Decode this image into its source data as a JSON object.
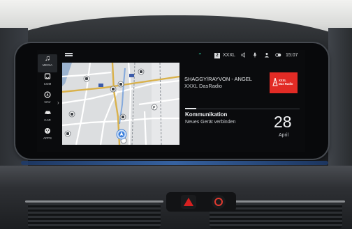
{
  "sidebar": {
    "items": [
      {
        "label": "MEDIA",
        "icon": "music-note-icon",
        "active": true
      },
      {
        "label": "COM",
        "icon": "phone-icon",
        "active": false
      },
      {
        "label": "NAV",
        "icon": "navigation-icon",
        "active": false
      },
      {
        "label": "CAR",
        "icon": "car-icon",
        "active": false
      },
      {
        "label": "APPS",
        "icon": "apps-icon",
        "active": false
      }
    ]
  },
  "status_bar": {
    "signal_symbol": "⌃",
    "signal_box": "2",
    "radio_band": "XXXL",
    "time": "15:07"
  },
  "media": {
    "track_title": "SHAGGY/RAYVON - ANGEL",
    "station": "XXXL DasRadio",
    "logo_line1": "XXXL",
    "logo_line2": "Das Radio"
  },
  "communication": {
    "title": "Kommunikation",
    "subtitle": "Neues Gerät verbinden"
  },
  "date": {
    "day": "28",
    "month": "April"
  },
  "colors": {
    "accent_green": "#2ad3a2",
    "logo_red": "#e22b25",
    "hazard_red": "#d62020",
    "ambient_blue": "#3c6fb8"
  }
}
